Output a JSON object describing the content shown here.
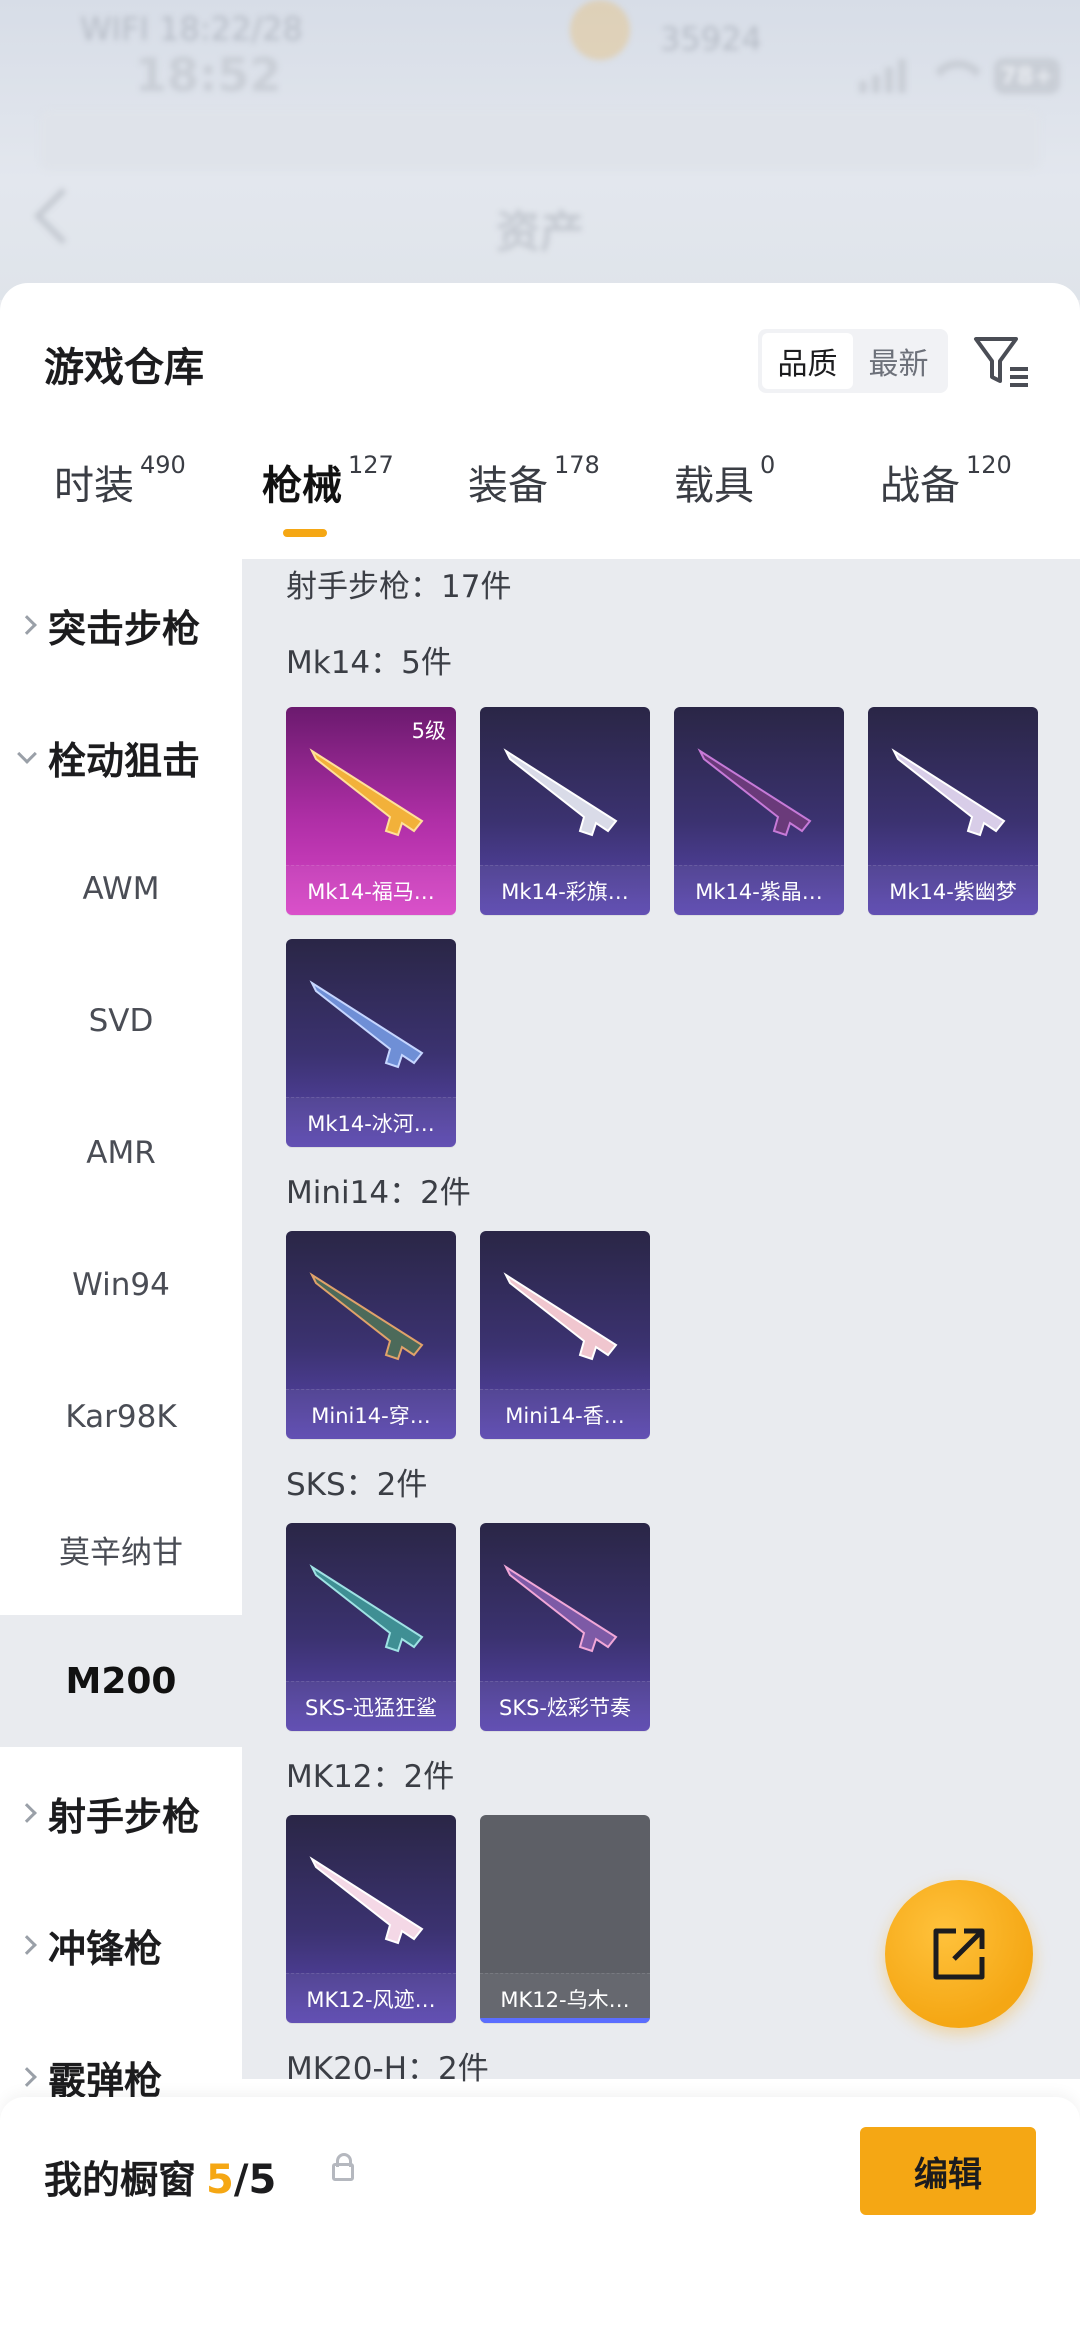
{
  "status_bar": {
    "time": "18:52",
    "battery": "78+",
    "ghost_text": "WIFI  18:22/28",
    "ghost_count": "35924"
  },
  "nav": {
    "title": "资产"
  },
  "sheet": {
    "title": "游戏仓库",
    "sort_options": [
      "品质",
      "最新"
    ],
    "categories": [
      {
        "name": "时装",
        "count": "490"
      },
      {
        "name": "枪械",
        "count": "127"
      },
      {
        "name": "装备",
        "count": "178"
      },
      {
        "name": "载具",
        "count": "0"
      },
      {
        "name": "战备",
        "count": "120"
      }
    ]
  },
  "sidebar": {
    "groups": [
      {
        "label": "突击步枪"
      },
      {
        "label": "栓动狙击"
      },
      {
        "label": "射手步枪"
      },
      {
        "label": "冲锋枪"
      },
      {
        "label": "霰弹枪"
      }
    ],
    "sub_items": [
      "AWM",
      "SVD",
      "AMR",
      "Win94",
      "Kar98K",
      "莫辛纳甘",
      "M200"
    ],
    "selected": "M200"
  },
  "content": {
    "header": "射手步枪：17件",
    "sections": [
      {
        "title": "Mk14：5件",
        "items": [
          {
            "name": "Mk14-福马…",
            "level": "5级",
            "style": "pink"
          },
          {
            "name": "Mk14-彩旗…",
            "style": "purple"
          },
          {
            "name": "Mk14-紫晶…",
            "style": "purple"
          },
          {
            "name": "Mk14-紫幽梦",
            "style": "purple"
          },
          {
            "name": "Mk14-冰河…",
            "style": "purple"
          }
        ]
      },
      {
        "title": "Mini14：2件",
        "items": [
          {
            "name": "Mini14-穿…",
            "style": "purple"
          },
          {
            "name": "Mini14-香…",
            "style": "purple"
          }
        ]
      },
      {
        "title": "SKS：2件",
        "items": [
          {
            "name": "SKS-迅猛狂鲨",
            "style": "purple"
          },
          {
            "name": "SKS-炫彩节奏",
            "style": "purple"
          }
        ]
      },
      {
        "title": "MK12：2件",
        "items": [
          {
            "name": "MK12-风迹…",
            "style": "purple"
          },
          {
            "name": "MK12-乌木…",
            "style": "gray"
          }
        ]
      },
      {
        "title": "MK20-H：2件",
        "items": []
      }
    ]
  },
  "bottom": {
    "title": "我的橱窗",
    "current": "5",
    "total": "/5",
    "edit_label": "编辑"
  },
  "colors": {
    "accent": "#f5a714",
    "card_purple": "#3b3270",
    "card_pink": "#b02fa7"
  },
  "icons": {
    "filter": "filter-icon",
    "share": "share-external-icon",
    "lock": "lock-icon",
    "back": "back-arrow-icon"
  }
}
